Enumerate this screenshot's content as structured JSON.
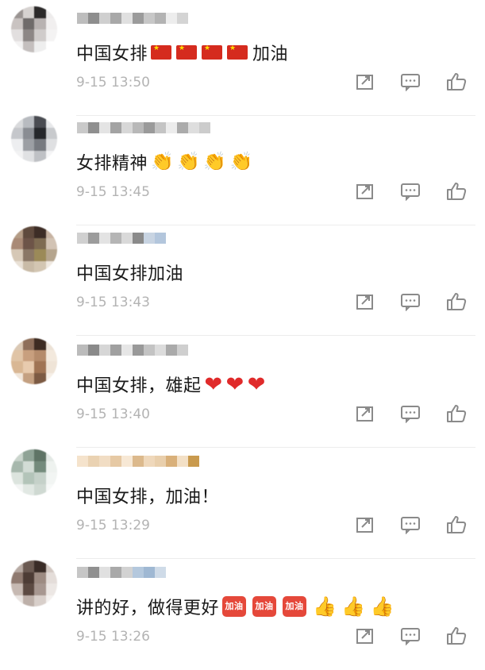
{
  "comments": [
    {
      "text": "中国女排",
      "text2": "加油",
      "time": "9-15 13:50",
      "emoji": "flag",
      "avatar": [
        "#9a9492",
        "#d6d2d0",
        "#2c2a2a",
        "#eeecec",
        "#c9c3c1",
        "#6f6b6a",
        "#b8b2b1",
        "#f1efef",
        "#e2dfdf",
        "#8d8786",
        "#d0cccb",
        "#f4f3f3",
        "#f3f2f2",
        "#c4bfbe",
        "#eeeeee",
        "#ffffff"
      ],
      "name_blocks": [
        "#bdbdbd",
        "#8e8e8e",
        "#cfcfcf",
        "#a8a8a8",
        "#e0e0e0",
        "#9b9b9b",
        "#c7c7c7",
        "#b3b3b3",
        "#ededed",
        "#d4d4d4"
      ]
    },
    {
      "text": "女排精神",
      "text2": "",
      "time": "9-15 13:45",
      "emoji": "clap",
      "avatar": [
        "#d9dadc",
        "#b8bbc0",
        "#4a4c52",
        "#e7e8ea",
        "#c5c7cb",
        "#8a8d93",
        "#25272b",
        "#c8cacd",
        "#edeef0",
        "#9c9fa4",
        "#777a80",
        "#dfe0e2",
        "#f2f2f3",
        "#e0e1e3",
        "#bfc1c5",
        "#f5f5f6"
      ],
      "name_blocks": [
        "#c9c9c9",
        "#8f8f8f",
        "#e4e4e4",
        "#a3a3a3",
        "#d7d7d7",
        "#b8b8b8",
        "#9a9a9a",
        "#c4c4c4",
        "#ececec",
        "#ababab",
        "#dedede",
        "#cccccc"
      ]
    },
    {
      "text": "中国女排加油",
      "text2": "",
      "time": "9-15 13:43",
      "emoji": "",
      "avatar": [
        "#b49c86",
        "#5f4a3d",
        "#3d2d26",
        "#c7b3a2",
        "#a98a76",
        "#6d5448",
        "#7e6b52",
        "#d2c3b4",
        "#d6c8b6",
        "#8a7766",
        "#9b8a58",
        "#b5a58e",
        "#e9e1d6",
        "#c9bba7",
        "#d3c6b2",
        "#efe9e1"
      ],
      "name_blocks": [
        "#d0d0d0",
        "#9c9c9c",
        "#e3e3e3",
        "#b5b5b5",
        "#d9d9d9",
        "#8a8a8a",
        "#c8d4e2",
        "#b3c6dc"
      ]
    },
    {
      "text": "中国女排，雄起",
      "text2": "",
      "time": "9-15 13:40",
      "emoji": "heart",
      "avatar": [
        "#dac8b4",
        "#8e6f5a",
        "#3e2c22",
        "#ece2d6",
        "#e0c4a6",
        "#c89f7e",
        "#b58b6b",
        "#f3e9dd",
        "#d9b794",
        "#e8cbae",
        "#a07454",
        "#efe4d7",
        "#f1e6da",
        "#c4a081",
        "#7c5a43",
        "#f6efe7"
      ],
      "name_blocks": [
        "#bbbbbb",
        "#8a8a8a",
        "#d6d6d6",
        "#a0a0a0",
        "#e6e6e6",
        "#999999",
        "#c3c3c3",
        "#dcdcdc",
        "#aaaaaa",
        "#cfcfcf"
      ]
    },
    {
      "text": "中国女排，加油！",
      "text2": "",
      "time": "9-15 13:29",
      "emoji": "",
      "avatar": [
        "#c9d4cc",
        "#8fa396",
        "#5f7466",
        "#e3e9e5",
        "#a7b8ad",
        "#d2dcd5",
        "#748b7c",
        "#eef2ef",
        "#dce4de",
        "#b3c4b9",
        "#c5d1c9",
        "#f2f5f3",
        "#f3f5f4",
        "#e1e8e3",
        "#cfd9d2",
        "#f7f9f8"
      ],
      "name_blocks": [
        "#f5e3cc",
        "#ead2b2",
        "#f1ddc4",
        "#e6c9a4",
        "#f7e8d5",
        "#dcb98c",
        "#efd8bb",
        "#e9cfac",
        "#d9b07a",
        "#f3e0c6",
        "#c99a4e"
      ]
    },
    {
      "text": "讲的好，做得更好",
      "text2": "",
      "time": "9-15 13:26",
      "emoji": "mixed",
      "avatar": [
        "#b7aaa3",
        "#6b5a52",
        "#3a2c27",
        "#d2c8c2",
        "#8f7a70",
        "#4d3c35",
        "#9d8b82",
        "#e4ddd9",
        "#c6b9b2",
        "#5c4a42",
        "#a79790",
        "#ece7e4",
        "#e9e4e1",
        "#bdb0a9",
        "#d8cfca",
        "#f4f1ef"
      ],
      "name_blocks": [
        "#c6c6c6",
        "#909090",
        "#e0e0e0",
        "#a9a9a9",
        "#d2d2d2",
        "#b4c8dd",
        "#9fb8d3",
        "#cfdbe8"
      ]
    }
  ]
}
